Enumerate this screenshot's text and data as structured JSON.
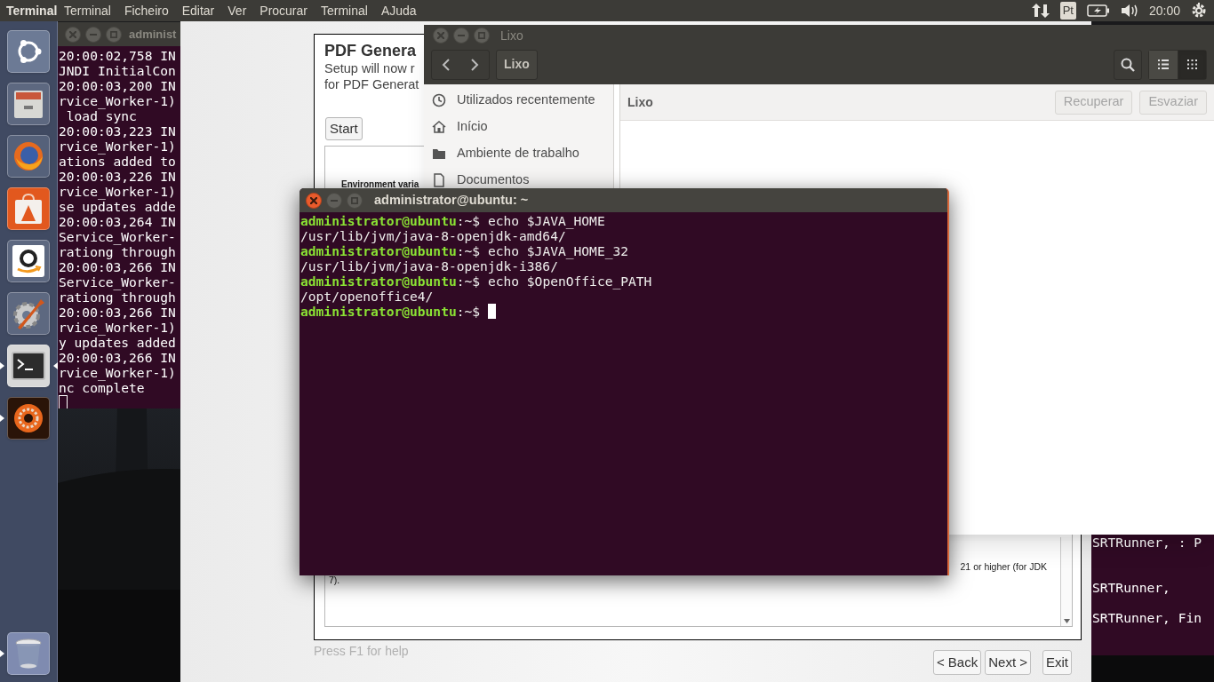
{
  "top_bar": {
    "app_title": "Terminal",
    "menus": [
      "Terminal",
      "Ficheiro",
      "Editar",
      "Ver",
      "Procurar",
      "Terminal",
      "AJuda"
    ],
    "keyboard_layout": "Pt",
    "clock": "20:00"
  },
  "launcher": {
    "items": [
      {
        "kind": "dash",
        "running": false,
        "focused": false
      },
      {
        "kind": "files",
        "running": false,
        "focused": false
      },
      {
        "kind": "browser",
        "running": false,
        "focused": false
      },
      {
        "kind": "software",
        "running": false,
        "focused": false
      },
      {
        "kind": "shop",
        "running": false,
        "focused": false
      },
      {
        "kind": "settings",
        "running": false,
        "focused": false
      },
      {
        "kind": "terminal",
        "running": true,
        "focused": true
      },
      {
        "kind": "app",
        "running": true,
        "focused": false
      },
      {
        "kind": "trash",
        "running": true,
        "focused": false
      }
    ]
  },
  "log_terminal": {
    "title": "administ",
    "lines": [
      "20:00:02,758 IN",
      "JNDI InitialCon",
      "20:00:03,200 IN",
      "rvice_Worker-1)",
      " load sync",
      "20:00:03,223 IN",
      "rvice_Worker-1)",
      "ations added to",
      "20:00:03,226 IN",
      "rvice_Worker-1)",
      "se updates adde",
      "20:00:03,264 IN",
      "Service_Worker-",
      "rationg through",
      "20:00:03,266 IN",
      "Service_Worker-",
      "rationg through",
      "20:00:03,266 IN",
      "rvice_Worker-1)",
      "y updates added",
      "20:00:03,266 IN",
      "rvice_Worker-1)",
      "nc complete"
    ]
  },
  "back_terminal": {
    "lines": [
      "SRTRunner, : P",
      "SRTRunner,",
      "SRTRunner, Fin"
    ]
  },
  "installer": {
    "title": "PDF Genera",
    "subtitle_lines": [
      "Setup will now r",
      "for PDF Generat"
    ],
    "start_button": "Start",
    "section_heading": "Environment varia",
    "text_fragments": [
      "21 or higher (for JDK",
      "7)."
    ],
    "help": "Press F1 for help",
    "buttons": [
      "< Back",
      "Next >",
      "Exit"
    ]
  },
  "file_manager": {
    "title": "Lixo",
    "path_button": "Lixo",
    "view_modes": [
      {
        "kind": "list",
        "selected": false
      },
      {
        "kind": "grid",
        "selected": true
      }
    ],
    "sidebar": [
      {
        "kind": "recent",
        "label": "Utilizados recentemente"
      },
      {
        "kind": "home",
        "label": "Início"
      },
      {
        "kind": "folder",
        "label": "Ambiente de trabalho"
      },
      {
        "kind": "document",
        "label": "Documentos"
      }
    ],
    "location": "Lixo",
    "actions": [
      {
        "label": "Recuperar",
        "disabled": true
      },
      {
        "label": "Esvaziar",
        "disabled": true
      }
    ]
  },
  "terminal": {
    "title": "administrator@ubuntu: ~",
    "lines": [
      {
        "kind": "prompt",
        "user": "administrator@ubuntu",
        "command": ":~$ echo $JAVA_HOME",
        "cursor": false
      },
      {
        "kind": "output",
        "text": "/usr/lib/jvm/java-8-openjdk-amd64/"
      },
      {
        "kind": "prompt",
        "user": "administrator@ubuntu",
        "command": ":~$ echo $JAVA_HOME_32",
        "cursor": false
      },
      {
        "kind": "output",
        "text": "/usr/lib/jvm/java-8-openjdk-i386/"
      },
      {
        "kind": "prompt",
        "user": "administrator@ubuntu",
        "command": ":~$ echo $OpenOffice_PATH",
        "cursor": false
      },
      {
        "kind": "output",
        "text": "/opt/openoffice4/"
      },
      {
        "kind": "prompt",
        "user": "administrator@ubuntu",
        "command": ":~$ ",
        "cursor": true
      }
    ]
  }
}
